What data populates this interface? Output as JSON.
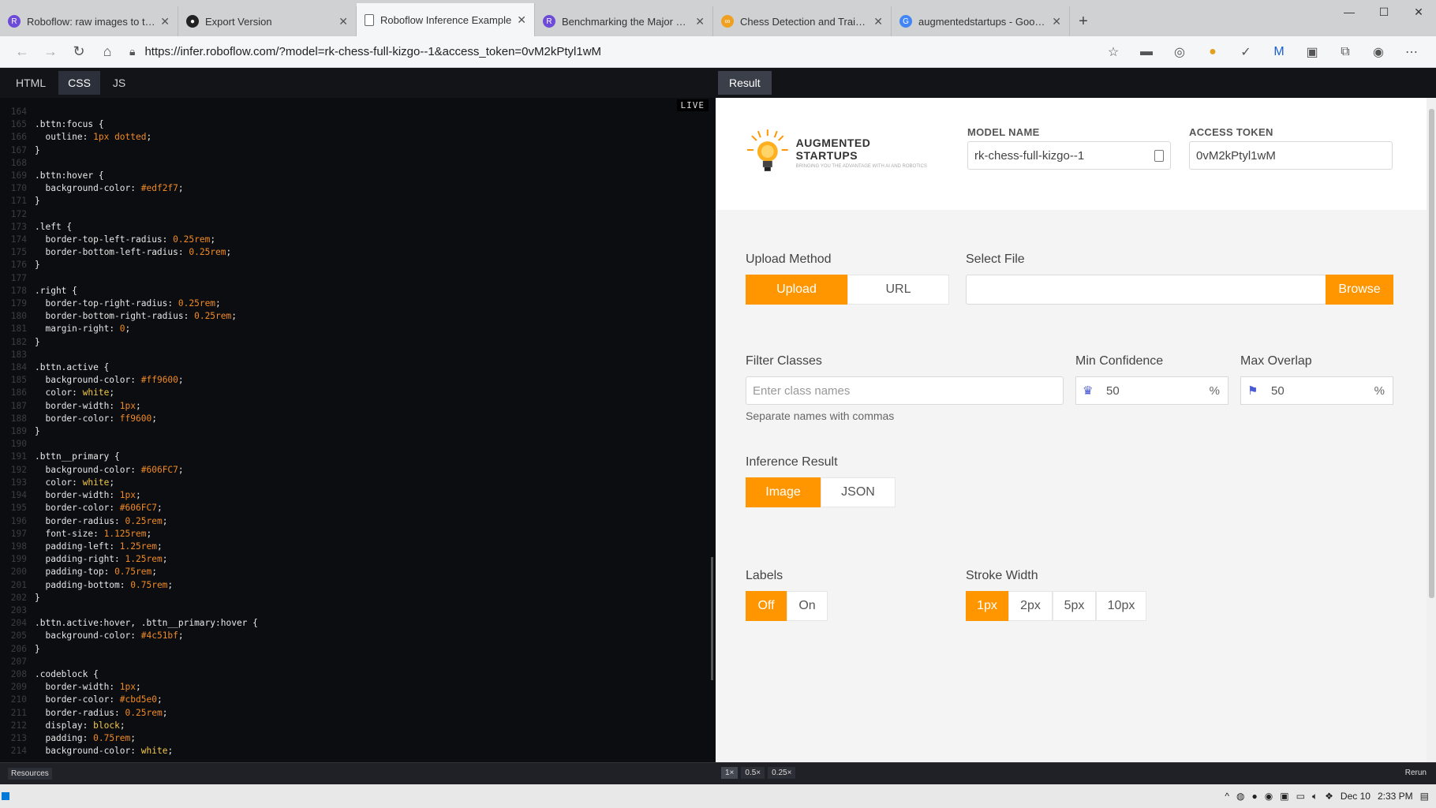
{
  "browser": {
    "tabs": [
      {
        "label": "Roboflow: raw images to trained",
        "icon": "roboflow-icon",
        "color": "#6c4bd8"
      },
      {
        "label": "Export Version",
        "icon": "github-icon",
        "color": "#222222"
      },
      {
        "label": "Roboflow Inference Example",
        "icon": "page-icon",
        "color": "#555555",
        "active": true
      },
      {
        "label": "Benchmarking the Major Cloud",
        "icon": "roboflow-icon",
        "color": "#6c4bd8"
      },
      {
        "label": "Chess Detection and Training usi",
        "icon": "codepen-icon",
        "color": "#f0a020"
      },
      {
        "label": "augmentedstartups - Google Se",
        "icon": "google-icon",
        "color": "#4285f4"
      }
    ],
    "url": "https://infer.roboflow.com/?model=rk-chess-full-kizgo--1&access_token=0vM2kPtyl1wM"
  },
  "pen": {
    "tabs": [
      "HTML",
      "CSS",
      "JS"
    ],
    "active_tab": "CSS",
    "result_tab": "Result",
    "live_badge": "LIVE",
    "code_lines": [
      {
        "n": "164",
        "t": "  "
      },
      {
        "n": "165",
        "t": ".bttn:focus {"
      },
      {
        "n": "166",
        "t": "  outline: 1px dotted;"
      },
      {
        "n": "167",
        "t": "}"
      },
      {
        "n": "168",
        "t": ""
      },
      {
        "n": "169",
        "t": ".bttn:hover {"
      },
      {
        "n": "170",
        "t": "  background-color: #edf2f7;"
      },
      {
        "n": "171",
        "t": "}"
      },
      {
        "n": "172",
        "t": ""
      },
      {
        "n": "173",
        "t": ".left {"
      },
      {
        "n": "174",
        "t": "  border-top-left-radius: 0.25rem;"
      },
      {
        "n": "175",
        "t": "  border-bottom-left-radius: 0.25rem;"
      },
      {
        "n": "176",
        "t": "}"
      },
      {
        "n": "177",
        "t": ""
      },
      {
        "n": "178",
        "t": ".right {"
      },
      {
        "n": "179",
        "t": "  border-top-right-radius: 0.25rem;"
      },
      {
        "n": "180",
        "t": "  border-bottom-right-radius: 0.25rem;"
      },
      {
        "n": "181",
        "t": "  margin-right: 0;"
      },
      {
        "n": "182",
        "t": "}"
      },
      {
        "n": "183",
        "t": ""
      },
      {
        "n": "184",
        "t": ".bttn.active {"
      },
      {
        "n": "185",
        "t": "  background-color: #ff9600;"
      },
      {
        "n": "186",
        "t": "  color: white;"
      },
      {
        "n": "187",
        "t": "  border-width: 1px;"
      },
      {
        "n": "188",
        "t": "  border-color: ff9600;"
      },
      {
        "n": "189",
        "t": "}"
      },
      {
        "n": "190",
        "t": ""
      },
      {
        "n": "191",
        "t": ".bttn__primary {"
      },
      {
        "n": "192",
        "t": "  background-color: #606FC7;"
      },
      {
        "n": "193",
        "t": "  color: white;"
      },
      {
        "n": "194",
        "t": "  border-width: 1px;"
      },
      {
        "n": "195",
        "t": "  border-color: #606FC7;"
      },
      {
        "n": "196",
        "t": "  border-radius: 0.25rem;"
      },
      {
        "n": "197",
        "t": "  font-size: 1.125rem;"
      },
      {
        "n": "198",
        "t": "  padding-left: 1.25rem;"
      },
      {
        "n": "199",
        "t": "  padding-right: 1.25rem;"
      },
      {
        "n": "200",
        "t": "  padding-top: 0.75rem;"
      },
      {
        "n": "201",
        "t": "  padding-bottom: 0.75rem;"
      },
      {
        "n": "202",
        "t": "}"
      },
      {
        "n": "203",
        "t": ""
      },
      {
        "n": "204",
        "t": ".bttn.active:hover, .bttn__primary:hover {"
      },
      {
        "n": "205",
        "t": "  background-color: #4c51bf;"
      },
      {
        "n": "206",
        "t": "}"
      },
      {
        "n": "207",
        "t": ""
      },
      {
        "n": "208",
        "t": ".codeblock {"
      },
      {
        "n": "209",
        "t": "  border-width: 1px;"
      },
      {
        "n": "210",
        "t": "  border-color: #cbd5e0;"
      },
      {
        "n": "211",
        "t": "  border-radius: 0.25rem;"
      },
      {
        "n": "212",
        "t": "  display: block;"
      },
      {
        "n": "213",
        "t": "  padding: 0.75rem;"
      },
      {
        "n": "214",
        "t": "  background-color: white;"
      }
    ],
    "footer": {
      "resources": "Resources",
      "zoom": [
        "1×",
        "0.5×",
        "0.25×"
      ],
      "rerun": "Rerun"
    }
  },
  "app": {
    "logo": {
      "title": "AUGMENTED STARTUPS",
      "tagline": "BRINGING YOU THE ADVANTAGE WITH AI AND ROBOTICS"
    },
    "model_name": {
      "label": "MODEL NAME",
      "value": "rk-chess-full-kizgo--1"
    },
    "access_token": {
      "label": "ACCESS TOKEN",
      "value": "0vM2kPtyl1wM"
    },
    "upload_method": {
      "label": "Upload Method",
      "options": [
        "Upload",
        "URL"
      ],
      "selected": "Upload"
    },
    "select_file": {
      "label": "Select File",
      "value": "",
      "browse": "Browse"
    },
    "filter_classes": {
      "label": "Filter Classes",
      "placeholder": "Enter class names",
      "hint": "Separate names with commas"
    },
    "min_confidence": {
      "label": "Min Confidence",
      "value": "50",
      "unit": "%"
    },
    "max_overlap": {
      "label": "Max Overlap",
      "value": "50",
      "unit": "%"
    },
    "inference_result": {
      "label": "Inference Result",
      "options": [
        "Image",
        "JSON"
      ],
      "selected": "Image"
    },
    "labels": {
      "label": "Labels",
      "options": [
        "Off",
        "On"
      ],
      "selected": "Off"
    },
    "stroke_width": {
      "label": "Stroke Width",
      "options": [
        "1px",
        "2px",
        "5px",
        "10px"
      ],
      "selected": "1px"
    },
    "accent": "#ff9600"
  },
  "taskbar": {
    "date": "Dec 10",
    "time": "2:33 PM"
  }
}
